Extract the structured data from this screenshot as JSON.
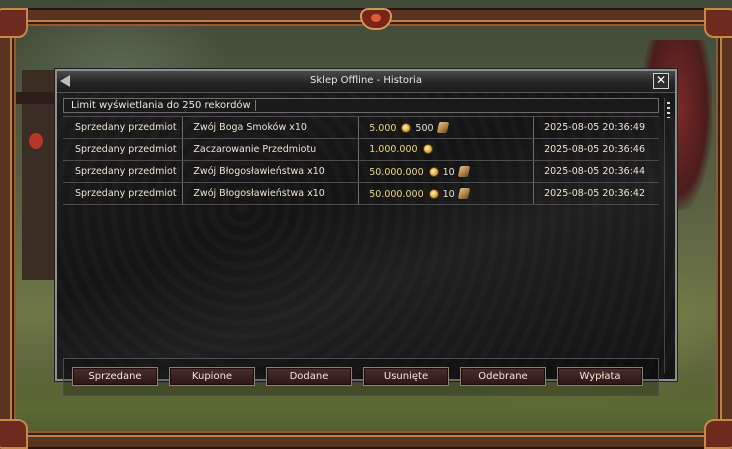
{
  "window": {
    "title": "Sklep Offline - Historia",
    "close_label": "✕"
  },
  "limit_label": "Limit wyświetlania do 250 rekordów",
  "rows": [
    {
      "type": "Sprzedany przedmiot",
      "item": "Zwój Boga Smoków x10",
      "yang": "5.000",
      "won": "500",
      "has_won": true,
      "date": "2025-08-05 20:36:49"
    },
    {
      "type": "Sprzedany przedmiot",
      "item": "Zaczarowanie Przedmiotu",
      "yang": "1.000.000",
      "won": "",
      "has_won": false,
      "date": "2025-08-05 20:36:46"
    },
    {
      "type": "Sprzedany przedmiot",
      "item": "Zwój Błogosławieństwa x10",
      "yang": "50.000.000",
      "won": "10",
      "has_won": true,
      "date": "2025-08-05 20:36:44"
    },
    {
      "type": "Sprzedany przedmiot",
      "item": "Zwój Błogosławieństwa x10",
      "yang": "50.000.000",
      "won": "10",
      "has_won": true,
      "date": "2025-08-05 20:36:42"
    }
  ],
  "tabs": [
    "Sprzedane",
    "Kupione",
    "Dodane",
    "Usunięte",
    "Odebrane",
    "Wypłata"
  ],
  "icons": {
    "currency_primary": "yang-coin-icon",
    "currency_secondary": "won-scroll-icon",
    "close": "close-icon"
  },
  "colors": {
    "frame": "#5a3320",
    "frame_trim": "#b9824a",
    "window_bg": "#141414",
    "button_bg": "#3a2220",
    "text": "#e8dfcf"
  }
}
